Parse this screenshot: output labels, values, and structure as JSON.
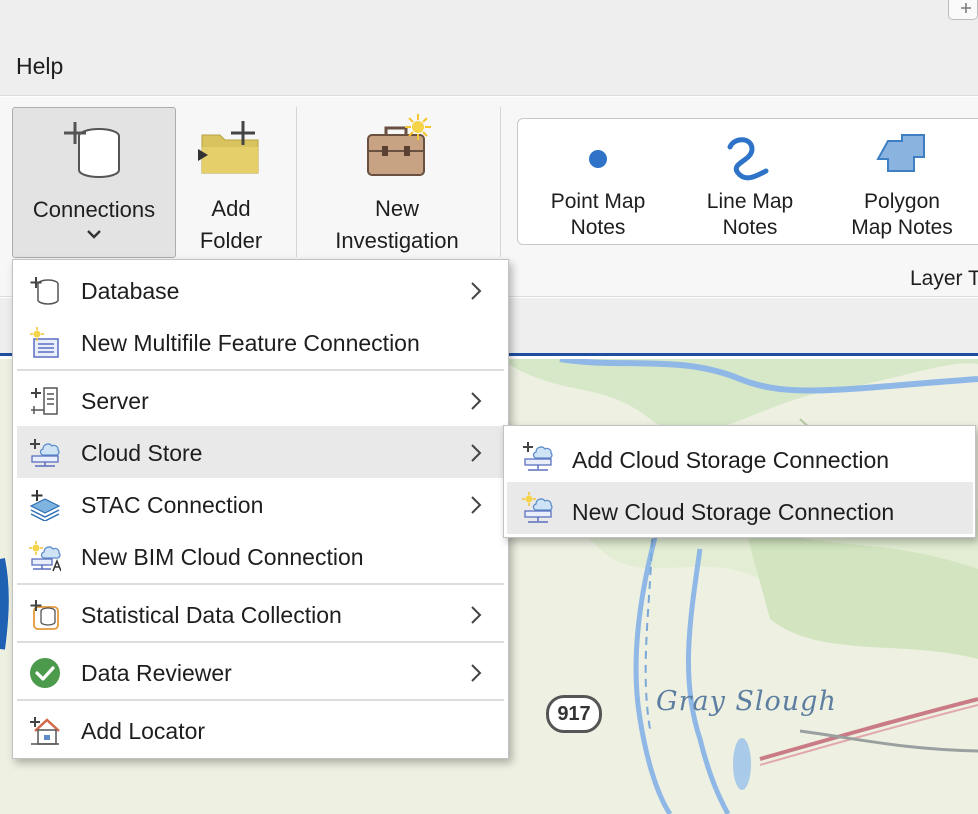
{
  "menubar": {
    "help_label": "Help"
  },
  "ribbon": {
    "connections_label": "Connections",
    "add_folder_line1": "Add",
    "add_folder_line2": "Folder",
    "new_investigation_line1": "New",
    "new_investigation_line2": "Investigation",
    "gallery": [
      {
        "line1": "Point Map",
        "line2": "Notes"
      },
      {
        "line1": "Line Map",
        "line2": "Notes"
      },
      {
        "line1": "Polygon",
        "line2": "Map Notes"
      }
    ],
    "group_label": "Layer T"
  },
  "dropdown": {
    "items": [
      {
        "label": "Database",
        "icon": "database-add-icon",
        "has_submenu": true
      },
      {
        "label": "New Multifile Feature Connection",
        "icon": "multifile-feature-icon",
        "has_submenu": false
      },
      {
        "label": "Server",
        "icon": "server-add-icon",
        "has_submenu": true
      },
      {
        "label": "Cloud Store",
        "icon": "cloud-store-icon",
        "has_submenu": true
      },
      {
        "label": "STAC Connection",
        "icon": "stac-layers-icon",
        "has_submenu": true
      },
      {
        "label": "New BIM Cloud Connection",
        "icon": "bim-cloud-icon",
        "has_submenu": false
      },
      {
        "label": "Statistical Data Collection",
        "icon": "statistical-data-icon",
        "has_submenu": true
      },
      {
        "label": "Data Reviewer",
        "icon": "check-circle-icon",
        "has_submenu": true
      },
      {
        "label": "Add Locator",
        "icon": "locator-house-icon",
        "has_submenu": false
      }
    ],
    "active_item": "Cloud Store"
  },
  "submenu": {
    "items": [
      {
        "label": "Add Cloud Storage Connection",
        "icon": "cloud-storage-add-icon"
      },
      {
        "label": "New Cloud Storage Connection",
        "icon": "cloud-storage-new-icon"
      }
    ],
    "active_item": "New Cloud Storage Connection"
  },
  "map": {
    "road_shield": "917",
    "place_label": "Gray Slough"
  },
  "colors": {
    "accent_blue": "#1f4f9e",
    "folder_yellow": "#d9c35e",
    "check_green": "#4c9a4c",
    "map_river": "#8fb8e6"
  }
}
